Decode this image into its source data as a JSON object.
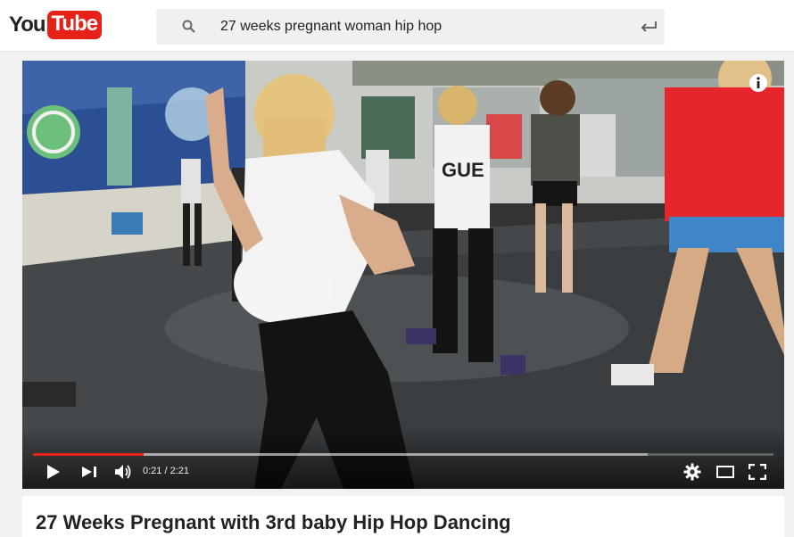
{
  "masthead": {
    "logo_you": "You",
    "logo_tube": "Tube",
    "search": {
      "value": "27 weeks pregnant woman hip hop",
      "icon": "search-icon"
    },
    "enter_icon": "return-arrow-icon"
  },
  "player": {
    "progress": {
      "played_fraction": 0.149,
      "loaded_fraction": 0.83
    },
    "time": {
      "current": "0:21",
      "duration": "2:21",
      "separator": " / "
    },
    "time_text": "0:21 / 2:21",
    "icons": {
      "info": "info-icon",
      "play": "play-icon",
      "next": "next-icon",
      "volume": "volume-icon",
      "settings": "gear-icon",
      "theater": "theater-mode-icon",
      "fullscreen": "fullscreen-icon"
    },
    "colors": {
      "progress_played": "#e62117"
    }
  },
  "video": {
    "title": "27 Weeks Pregnant with 3rd baby Hip Hop Dancing"
  },
  "colors": {
    "brand_red": "#e62117",
    "masthead_bg": "#ffffff",
    "page_bg": "#f1f1f1"
  }
}
